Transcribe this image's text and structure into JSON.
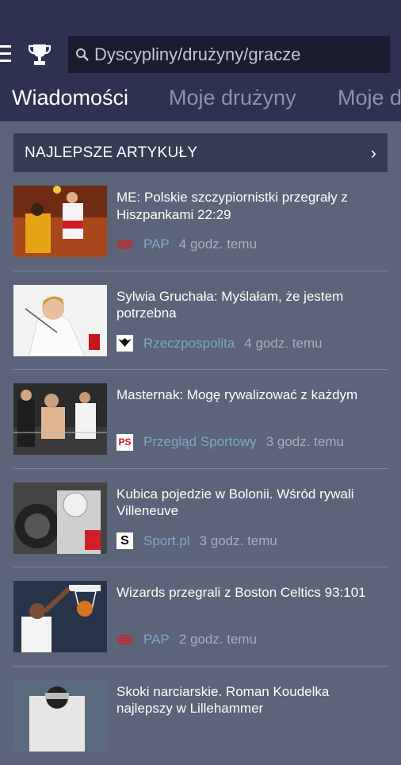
{
  "search": {
    "placeholder": "Dyscypliny/drużyny/gracze"
  },
  "tabs": [
    {
      "label": "Wiadomości",
      "active": true
    },
    {
      "label": "Moje drużyny",
      "active": false
    },
    {
      "label": "Moje dyscypliny",
      "active": false
    }
  ],
  "section": {
    "title": "NAJLEPSZE ARTYKUŁY",
    "chevron": "›"
  },
  "articles": [
    {
      "headline": "ME: Polskie szczypiornistki przegrały z Hiszpankami 22:29",
      "source": "PAP",
      "time": "4 godz. temu",
      "logo_icon": "pap-logo-icon"
    },
    {
      "headline": "Sylwia Gruchała: Myślałam, że jestem potrzebna",
      "source": "Rzeczpospolita",
      "time": "4 godz. temu",
      "logo_icon": "rzeczpospolita-eagle-icon"
    },
    {
      "headline": "Masternak: Mogę rywalizować z każdym",
      "source": "Przegląd Sportowy",
      "time": "3 godz. temu",
      "logo_icon": "ps-logo-icon"
    },
    {
      "headline": "Kubica pojedzie w Bolonii. Wśród rywali Villeneuve",
      "source": "Sport.pl",
      "time": "3 godz. temu",
      "logo_icon": "sport-pl-logo-icon"
    },
    {
      "headline": "Wizards przegrali z Boston Celtics 93:101",
      "source": "PAP",
      "time": "2 godz. temu",
      "logo_icon": "pap-logo-icon"
    },
    {
      "headline": "Skoki narciarskie. Roman Koudelka najlepszy w Lillehammer",
      "source": "",
      "time": "",
      "logo_icon": ""
    }
  ],
  "colors": {
    "topbar": "#2f3150",
    "background": "#5b6478",
    "section": "#343c54",
    "source_link": "#7ea8c5",
    "pap_red": "#c8262c"
  }
}
